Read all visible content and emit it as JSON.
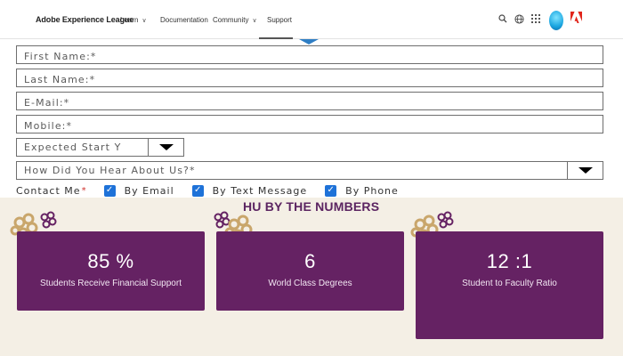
{
  "nav": {
    "brand": "Adobe Experience League",
    "items": [
      {
        "label": "Learn",
        "has_dropdown": true
      },
      {
        "label": "Documentation",
        "has_dropdown": false
      },
      {
        "label": "Community",
        "has_dropdown": true
      },
      {
        "label": "Support",
        "has_dropdown": false,
        "active": true
      }
    ],
    "icons": [
      "search-icon",
      "globe-icon",
      "apps-grid-icon",
      "avatar",
      "adobe-logo-icon"
    ]
  },
  "form": {
    "first_name_placeholder": "First Name:*",
    "last_name_placeholder": "Last Name:*",
    "email_placeholder": "E-Mail:*",
    "mobile_placeholder": "Mobile:*",
    "start_year_placeholder": "Expected Start Y",
    "hear_about_placeholder": "How Did You Hear About Us?*",
    "contact_me_label": "Contact Me",
    "required_mark": "*",
    "contact_options": [
      {
        "label": "By Email",
        "checked": true
      },
      {
        "label": "By Text Message",
        "checked": true
      },
      {
        "label": "By Phone",
        "checked": true
      }
    ]
  },
  "numbers": {
    "title": "HU BY THE NUMBERS",
    "cards": [
      {
        "value": "85 %",
        "caption": "Students Receive Financial Support"
      },
      {
        "value": "6",
        "caption": "World Class Degrees"
      },
      {
        "value": "12 :1",
        "caption": "Student to Faculty Ratio"
      }
    ]
  },
  "colors": {
    "accent_purple": "#652263",
    "title_purple": "#5b2461",
    "section_background": "#f4efe5",
    "checkbox_blue": "#1e72d8",
    "flower_gold": "#c9a66b"
  }
}
